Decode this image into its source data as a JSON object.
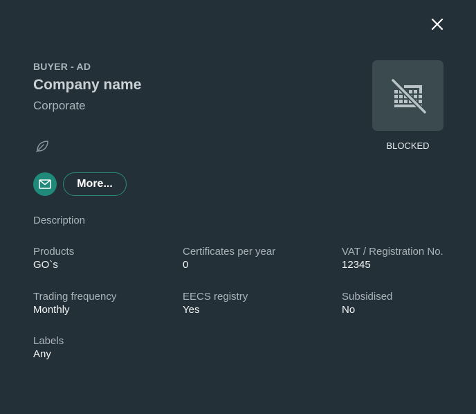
{
  "header": {
    "ad_type": "BUYER - AD",
    "company_name": "Company name",
    "company_type": "Corporate"
  },
  "actions": {
    "more_label": "More..."
  },
  "logo": {
    "status": "BLOCKED"
  },
  "description_label": "Description",
  "fields": {
    "products": {
      "label": "Products",
      "value": "GO`s"
    },
    "certificates": {
      "label": "Certificates per year",
      "value": "0"
    },
    "vat": {
      "label": "VAT / Registration No.",
      "value": "12345"
    },
    "trading_frequency": {
      "label": "Trading frequency",
      "value": "Monthly"
    },
    "eecs_registry": {
      "label": "EECS registry",
      "value": "Yes"
    },
    "subsidised": {
      "label": "Subsidised",
      "value": "No"
    },
    "labels": {
      "label": "Labels",
      "value": "Any"
    }
  },
  "colors": {
    "background": "#243038",
    "accent": "#1f8a7a",
    "logo_tile": "#3a4a4f"
  }
}
